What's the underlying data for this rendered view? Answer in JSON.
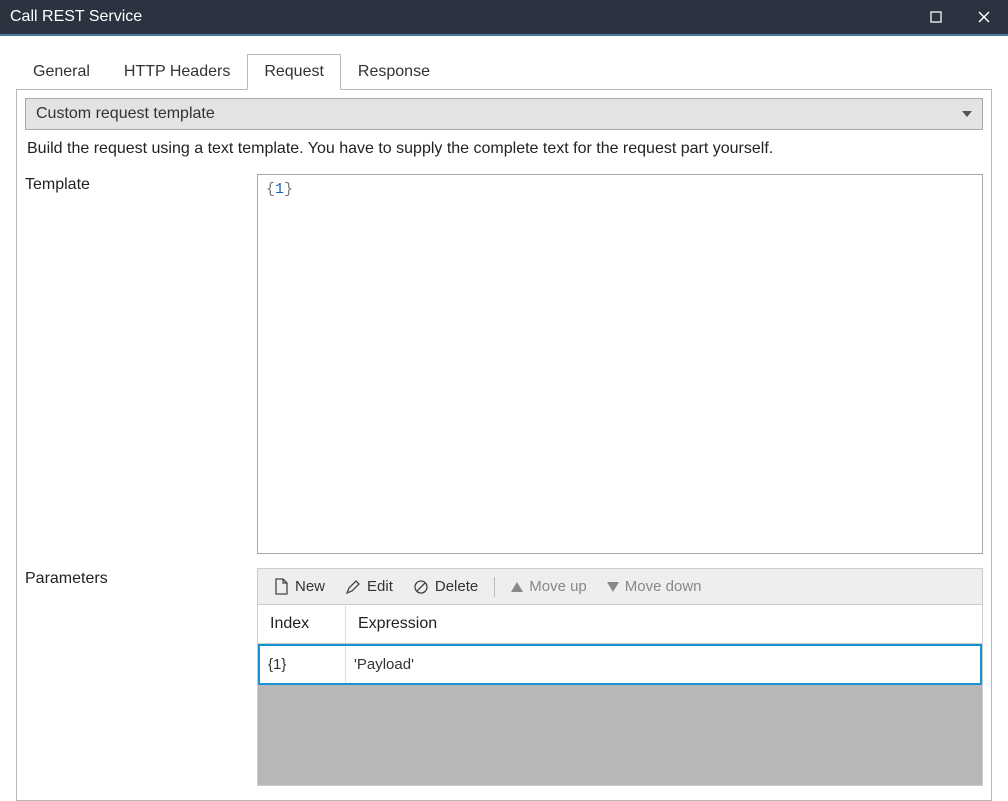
{
  "titlebar": {
    "title": "Call REST Service"
  },
  "tabs": [
    "General",
    "HTTP Headers",
    "Request",
    "Response"
  ],
  "active_tab_index": 2,
  "request": {
    "dropdown_value": "Custom request template",
    "help_text": "Build the request using a text template. You have to supply the complete text for the request part yourself.",
    "template_label": "Template",
    "template_value": "{1}",
    "parameters_label": "Parameters",
    "toolbar": {
      "new": "New",
      "edit": "Edit",
      "delete": "Delete",
      "move_up": "Move up",
      "move_down": "Move down"
    },
    "param_headers": {
      "index": "Index",
      "expression": "Expression"
    },
    "param_rows": [
      {
        "index": "{1}",
        "expression": "'Payload'"
      }
    ]
  }
}
